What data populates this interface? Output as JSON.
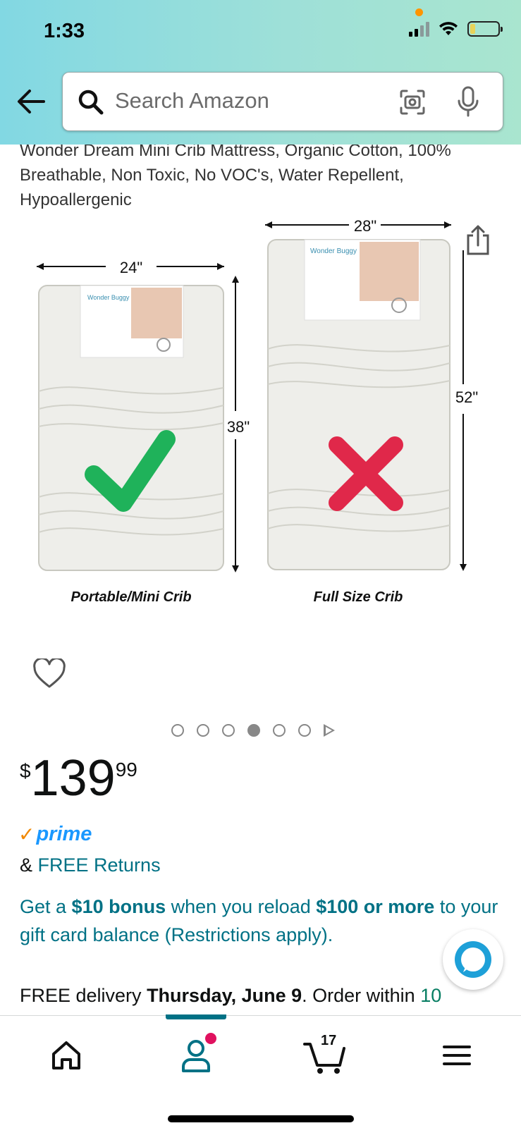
{
  "status_bar": {
    "time": "1:33"
  },
  "search": {
    "placeholder": "Search Amazon"
  },
  "product": {
    "title": "Wonder Dream Mini Crib Mattress, Organic Cotton, 100% Breathable, Non Toxic, No VOC's, Water Repellent, Hypoallergenic",
    "image": {
      "left_label": "Portable/Mini Crib",
      "right_label": "Full Size Crib",
      "left_width": "24\"",
      "left_height": "38\"",
      "right_width": "28\"",
      "right_height": "52\"",
      "package_brand": "Wonder Buggy"
    },
    "carousel": {
      "count": 6,
      "active_index": 3
    },
    "price": {
      "symbol": "$",
      "whole": "139",
      "fraction": "99"
    },
    "prime_label": "prime",
    "returns": {
      "prefix": "& ",
      "link": "FREE Returns"
    },
    "promo": {
      "part1": "Get a ",
      "bold1": "$10 bonus",
      "part2": " when you reload ",
      "bold2": "$100 or more",
      "part3": " to your gift card balance (Restrictions apply)."
    },
    "delivery": {
      "prefix": "FREE delivery ",
      "date": "Thursday, June 9",
      "suffix": ". Order within ",
      "countdown": "10"
    }
  },
  "bottom_nav": {
    "cart_count": "17"
  },
  "colors": {
    "link": "#007185",
    "prime_blue": "#1a98ff",
    "prime_check": "#f08804",
    "check_green": "#1fb25a",
    "cross_red": "#e0284a",
    "badge": "#e0115f"
  }
}
